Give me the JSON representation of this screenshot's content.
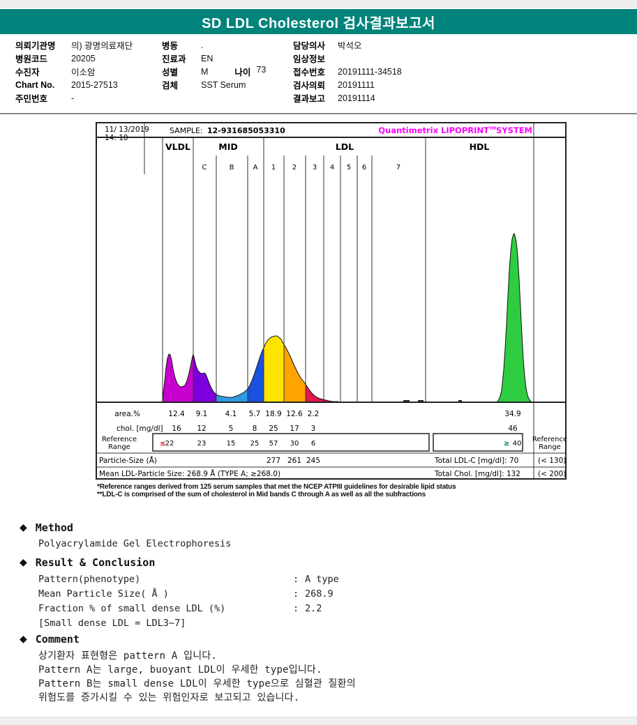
{
  "page": {
    "title": "SD LDL Cholesterol 검사결과보고서"
  },
  "patient": {
    "col1": [
      {
        "label": "의뢰기관명",
        "value": "의) 광명의료재단"
      },
      {
        "label": "병원코드",
        "value": "20205"
      },
      {
        "label": "수진자",
        "value": "이소암"
      },
      {
        "label": "Chart No.",
        "value": "2015-27513"
      },
      {
        "label": "주민번호",
        "value": "-"
      }
    ],
    "col2": [
      {
        "label": "병동",
        "value": "."
      },
      {
        "label": "진료과",
        "value": "EN"
      },
      {
        "label": "성별",
        "value": "M"
      },
      {
        "label": "검체",
        "value": "SST Serum"
      }
    ],
    "age": {
      "label": "나이",
      "value": "73"
    },
    "col3": [
      {
        "label": "담당의사",
        "value": "박석오"
      },
      {
        "label": "임상정보",
        "value": ""
      },
      {
        "label": "접수번호",
        "value": "20191111-34518"
      },
      {
        "label": "검사의뢰",
        "value": "20191111"
      },
      {
        "label": "결과보고",
        "value": "20191114"
      }
    ]
  },
  "chart": {
    "header": {
      "datetime1": "11/ 13/2019",
      "datetime2": "14: 10",
      "sample_label": "SAMPLE:",
      "sample_value": "12-931685053310",
      "brand_name": "Quantimetrix LIPOPRINT",
      "brand_tm": "TM",
      "brand_system": "SYSTEM"
    },
    "bands": [
      "VLDL",
      "MID",
      "LDL",
      "HDL"
    ],
    "subbands": [
      "C",
      "B",
      "A",
      "1",
      "2",
      "3",
      "4",
      "5",
      "6",
      "7"
    ],
    "rows": {
      "area_label": "area.%",
      "area": [
        "12.4",
        "9.1",
        "4.1",
        "5.7",
        "18.9",
        "12.6",
        "2.2"
      ],
      "area_hdl": "34.9",
      "chol_label": "chol. [mg/dl]",
      "chol": [
        "16",
        "12",
        "5",
        "8",
        "25",
        "17",
        "3"
      ],
      "chol_hdl": "46",
      "ref_label_line1": "Reference",
      "ref_label_line2": "Range",
      "ref_le": "≤",
      "ref": [
        "22",
        "23",
        "15",
        "25",
        "57",
        "30",
        "6"
      ],
      "ref_ge": "≥",
      "ref_hdl": "40",
      "particle_label": "Particle-Size (Å)",
      "particle": [
        "277",
        "261",
        "245"
      ],
      "mean_label": "Mean LDL-Particle Size:  268.9 Å  (TYPE A; ≥268.0)",
      "total_ldl": "Total LDL-C [mg/dl]:  70",
      "total_ldl_ref": "(< 130)",
      "total_chol": "Total Chol. [mg/dl]:  132",
      "total_chol_ref": "(< 200)"
    }
  },
  "chart_data": {
    "type": "area",
    "title": "Quantimetrix LIPOPRINT SYSTEM",
    "sample_id": "12-931685053310",
    "fractions": [
      {
        "band": "VLDL",
        "area_pct": 12.4,
        "chol_mgdl": 16,
        "ref_range": "≤ 22",
        "color": "#c800ce"
      },
      {
        "band": "MID C",
        "area_pct": 9.1,
        "chol_mgdl": 12,
        "ref_range": "23",
        "color": "#7b00db"
      },
      {
        "band": "MID B",
        "area_pct": 4.1,
        "chol_mgdl": 5,
        "ref_range": "15",
        "color": "#2f9be3"
      },
      {
        "band": "MID A",
        "area_pct": 5.7,
        "chol_mgdl": 8,
        "ref_range": "25",
        "color": "#1a52de"
      },
      {
        "band": "LDL 1",
        "area_pct": 18.9,
        "chol_mgdl": 25,
        "ref_range": "57",
        "particle_size_A": 277,
        "color": "#ffe400"
      },
      {
        "band": "LDL 2",
        "area_pct": 12.6,
        "chol_mgdl": 17,
        "ref_range": "30",
        "particle_size_A": 261,
        "color": "#ffa300"
      },
      {
        "band": "LDL 3",
        "area_pct": 2.2,
        "chol_mgdl": 3,
        "ref_range": "6",
        "particle_size_A": 245,
        "color": "#e3174b"
      },
      {
        "band": "HDL",
        "area_pct": 34.9,
        "chol_mgdl": 46,
        "ref_range": "≥ 40",
        "color": "#2ecc40"
      }
    ],
    "totals": {
      "mean_ldl_particle_size_A": 268.9,
      "type": "TYPE A; ≥268.0",
      "total_ldl_c_mgdl": 70,
      "total_ldl_c_ref": "< 130",
      "total_chol_mgdl": 132,
      "total_chol_ref": "< 200"
    }
  },
  "footnotes": [
    "*Reference ranges derived from 125 serum samples that met the NCEP ATPIII guidelines for desirable lipid status",
    "**LDL-C is comprised of the sum of cholesterol in Mid bands C through A as well as all the subfractions"
  ],
  "method": {
    "heading": "Method",
    "body": "Polyacrylamide Gel Electrophoresis"
  },
  "result": {
    "heading": "Result & Conclusion",
    "rows": [
      {
        "label": "Pattern(phenotype)",
        "value": "A type"
      },
      {
        "label": "Mean Particle Size( Å )",
        "value": "268.9"
      },
      {
        "label": "Fraction % of small dense LDL (%)",
        "value": "2.2"
      }
    ],
    "note": "[Small dense LDL = LDL3~7]"
  },
  "comment": {
    "heading": "Comment",
    "lines": [
      "상기환자 표현형은 pattern A 입니다.",
      "Pattern A는 large, buoyant LDL이 우세한 type입니다.",
      "Pattern B는 small dense LDL이 우세한 type으로 심혈관 질환의",
      "위험도를 증가시킬 수 있는 위험인자로 보고되고 있습니다."
    ]
  },
  "misc": {
    "colon": ":",
    "bullet": "◆"
  }
}
